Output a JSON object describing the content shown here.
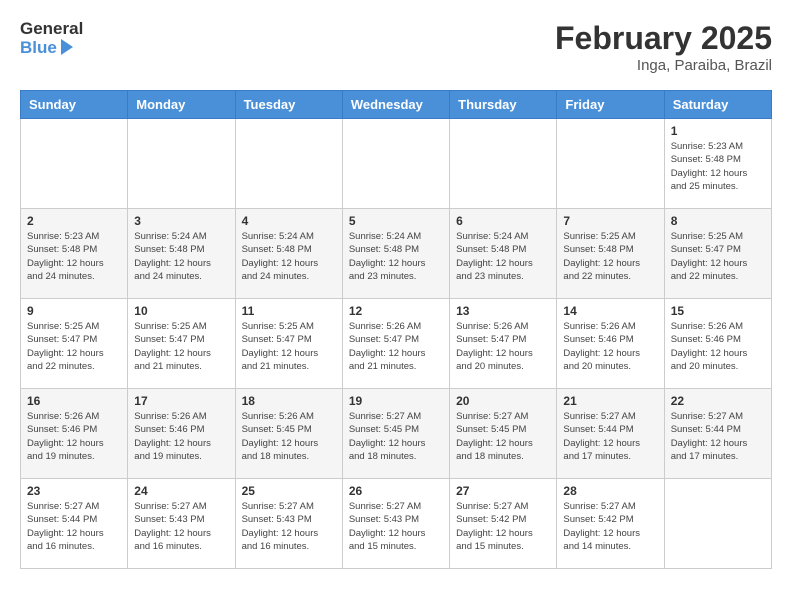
{
  "header": {
    "logo_general": "General",
    "logo_blue": "Blue",
    "title": "February 2025",
    "subtitle": "Inga, Paraiba, Brazil"
  },
  "days_of_week": [
    "Sunday",
    "Monday",
    "Tuesday",
    "Wednesday",
    "Thursday",
    "Friday",
    "Saturday"
  ],
  "weeks": [
    [
      {
        "day": "",
        "info": ""
      },
      {
        "day": "",
        "info": ""
      },
      {
        "day": "",
        "info": ""
      },
      {
        "day": "",
        "info": ""
      },
      {
        "day": "",
        "info": ""
      },
      {
        "day": "",
        "info": ""
      },
      {
        "day": "1",
        "info": "Sunrise: 5:23 AM\nSunset: 5:48 PM\nDaylight: 12 hours and 25 minutes."
      }
    ],
    [
      {
        "day": "2",
        "info": "Sunrise: 5:23 AM\nSunset: 5:48 PM\nDaylight: 12 hours and 24 minutes."
      },
      {
        "day": "3",
        "info": "Sunrise: 5:24 AM\nSunset: 5:48 PM\nDaylight: 12 hours and 24 minutes."
      },
      {
        "day": "4",
        "info": "Sunrise: 5:24 AM\nSunset: 5:48 PM\nDaylight: 12 hours and 24 minutes."
      },
      {
        "day": "5",
        "info": "Sunrise: 5:24 AM\nSunset: 5:48 PM\nDaylight: 12 hours and 23 minutes."
      },
      {
        "day": "6",
        "info": "Sunrise: 5:24 AM\nSunset: 5:48 PM\nDaylight: 12 hours and 23 minutes."
      },
      {
        "day": "7",
        "info": "Sunrise: 5:25 AM\nSunset: 5:48 PM\nDaylight: 12 hours and 22 minutes."
      },
      {
        "day": "8",
        "info": "Sunrise: 5:25 AM\nSunset: 5:47 PM\nDaylight: 12 hours and 22 minutes."
      }
    ],
    [
      {
        "day": "9",
        "info": "Sunrise: 5:25 AM\nSunset: 5:47 PM\nDaylight: 12 hours and 22 minutes."
      },
      {
        "day": "10",
        "info": "Sunrise: 5:25 AM\nSunset: 5:47 PM\nDaylight: 12 hours and 21 minutes."
      },
      {
        "day": "11",
        "info": "Sunrise: 5:25 AM\nSunset: 5:47 PM\nDaylight: 12 hours and 21 minutes."
      },
      {
        "day": "12",
        "info": "Sunrise: 5:26 AM\nSunset: 5:47 PM\nDaylight: 12 hours and 21 minutes."
      },
      {
        "day": "13",
        "info": "Sunrise: 5:26 AM\nSunset: 5:47 PM\nDaylight: 12 hours and 20 minutes."
      },
      {
        "day": "14",
        "info": "Sunrise: 5:26 AM\nSunset: 5:46 PM\nDaylight: 12 hours and 20 minutes."
      },
      {
        "day": "15",
        "info": "Sunrise: 5:26 AM\nSunset: 5:46 PM\nDaylight: 12 hours and 20 minutes."
      }
    ],
    [
      {
        "day": "16",
        "info": "Sunrise: 5:26 AM\nSunset: 5:46 PM\nDaylight: 12 hours and 19 minutes."
      },
      {
        "day": "17",
        "info": "Sunrise: 5:26 AM\nSunset: 5:46 PM\nDaylight: 12 hours and 19 minutes."
      },
      {
        "day": "18",
        "info": "Sunrise: 5:26 AM\nSunset: 5:45 PM\nDaylight: 12 hours and 18 minutes."
      },
      {
        "day": "19",
        "info": "Sunrise: 5:27 AM\nSunset: 5:45 PM\nDaylight: 12 hours and 18 minutes."
      },
      {
        "day": "20",
        "info": "Sunrise: 5:27 AM\nSunset: 5:45 PM\nDaylight: 12 hours and 18 minutes."
      },
      {
        "day": "21",
        "info": "Sunrise: 5:27 AM\nSunset: 5:44 PM\nDaylight: 12 hours and 17 minutes."
      },
      {
        "day": "22",
        "info": "Sunrise: 5:27 AM\nSunset: 5:44 PM\nDaylight: 12 hours and 17 minutes."
      }
    ],
    [
      {
        "day": "23",
        "info": "Sunrise: 5:27 AM\nSunset: 5:44 PM\nDaylight: 12 hours and 16 minutes."
      },
      {
        "day": "24",
        "info": "Sunrise: 5:27 AM\nSunset: 5:43 PM\nDaylight: 12 hours and 16 minutes."
      },
      {
        "day": "25",
        "info": "Sunrise: 5:27 AM\nSunset: 5:43 PM\nDaylight: 12 hours and 16 minutes."
      },
      {
        "day": "26",
        "info": "Sunrise: 5:27 AM\nSunset: 5:43 PM\nDaylight: 12 hours and 15 minutes."
      },
      {
        "day": "27",
        "info": "Sunrise: 5:27 AM\nSunset: 5:42 PM\nDaylight: 12 hours and 15 minutes."
      },
      {
        "day": "28",
        "info": "Sunrise: 5:27 AM\nSunset: 5:42 PM\nDaylight: 12 hours and 14 minutes."
      },
      {
        "day": "",
        "info": ""
      }
    ]
  ]
}
